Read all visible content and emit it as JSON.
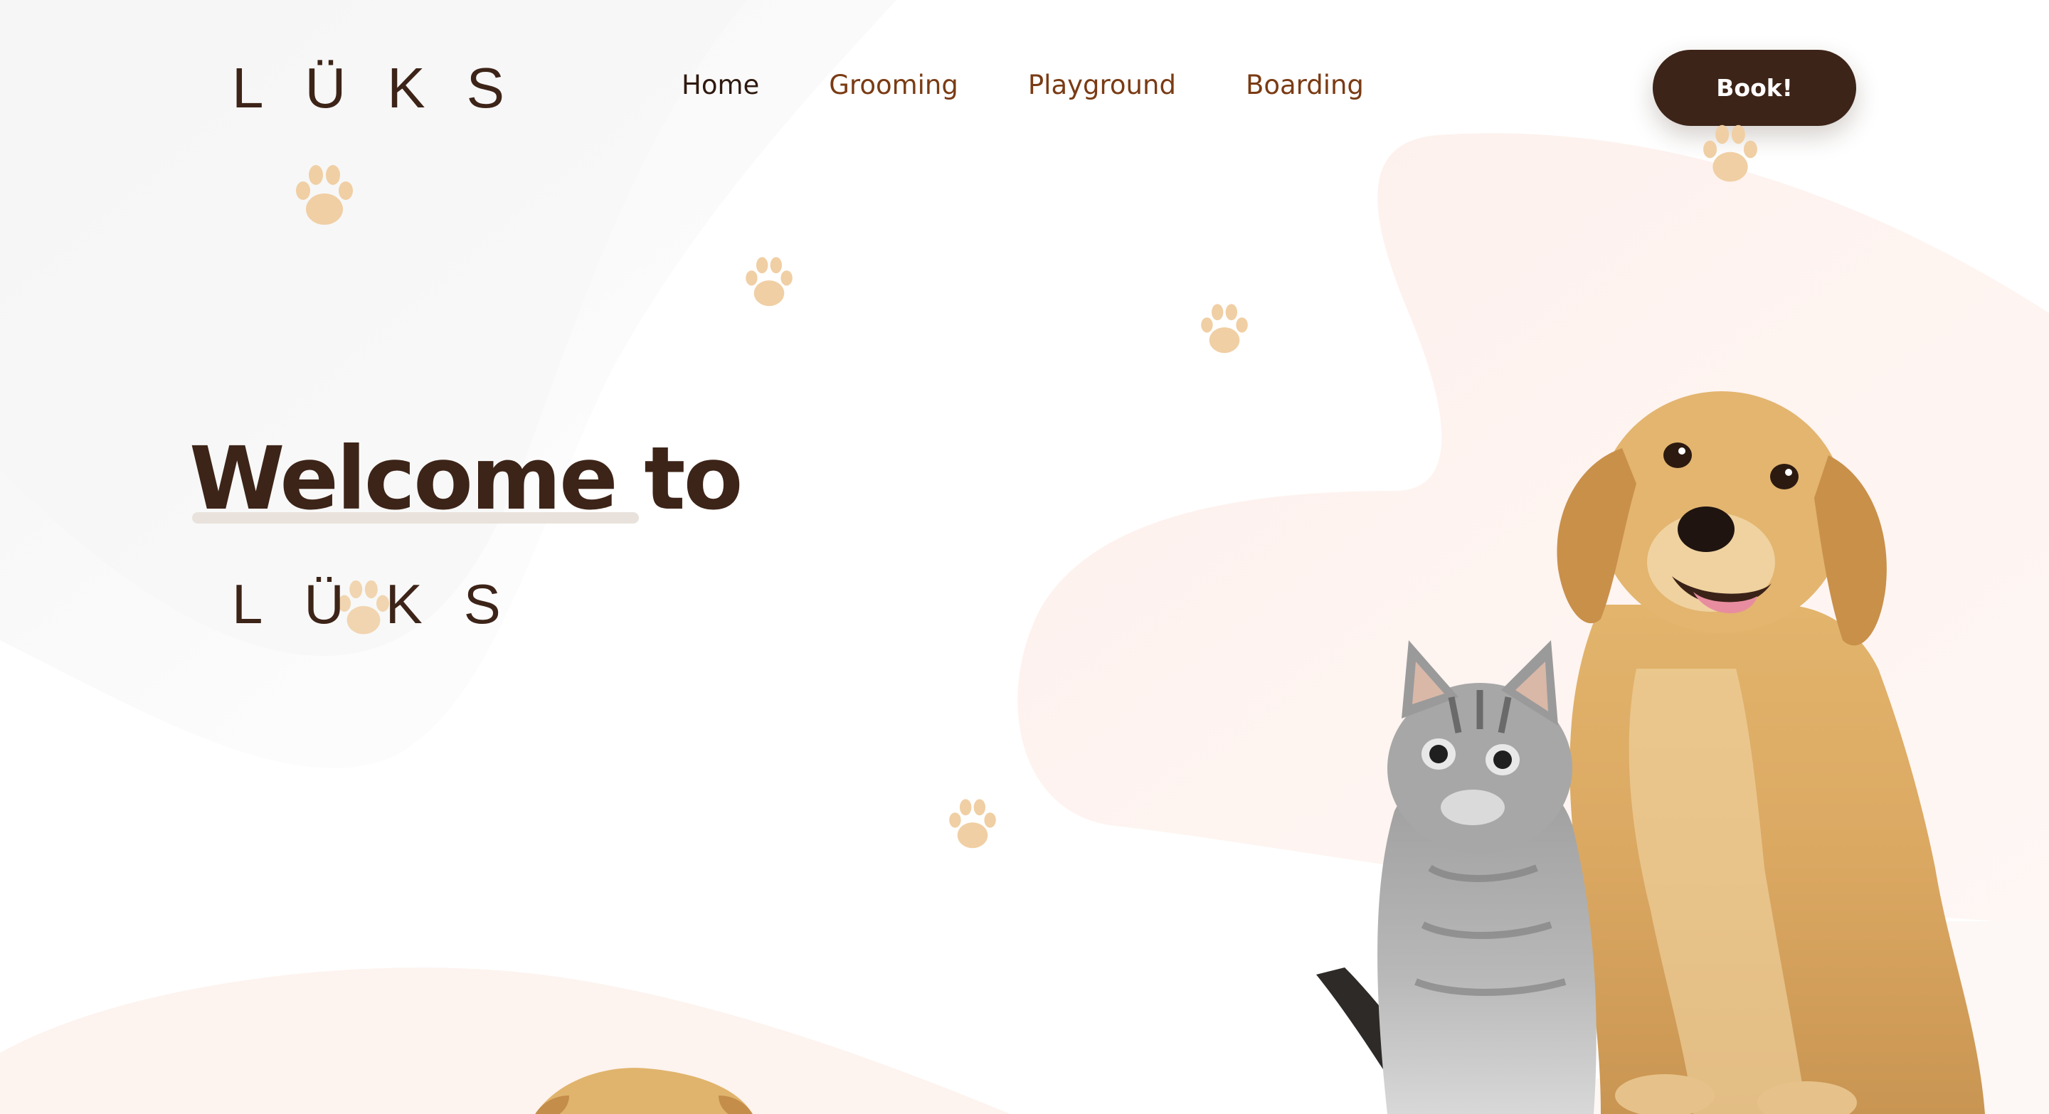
{
  "brand": {
    "logo_text": "LÜKS"
  },
  "nav": {
    "items": [
      {
        "label": "Home"
      },
      {
        "label": "Grooming"
      },
      {
        "label": "Playground"
      },
      {
        "label": "Boarding"
      }
    ]
  },
  "header": {
    "book_label": "Book!"
  },
  "hero": {
    "title": "Welcome to",
    "brand_text": "LÜKS"
  },
  "colors": {
    "brand_dark": "#3d2418",
    "nav_link": "#7a3b14",
    "paw": "#f0cfa4",
    "blob": "#fdf1ee"
  },
  "icons": [
    "paw-icon",
    "puppy-image",
    "kitten-image"
  ]
}
